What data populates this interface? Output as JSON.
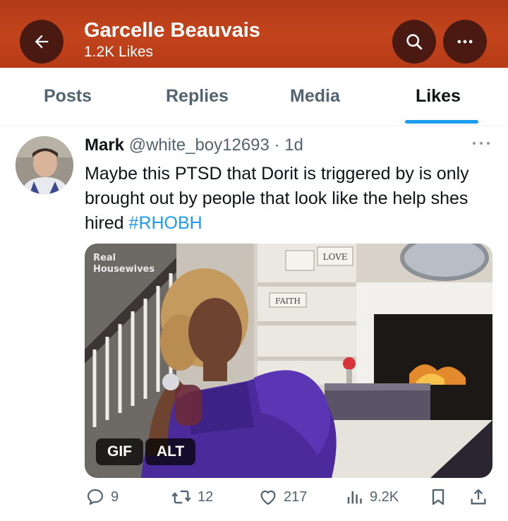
{
  "header": {
    "title": "Garcelle Beauvais",
    "subtitle": "1.2K Likes",
    "back_icon": "arrow-left-icon",
    "search_icon": "search-icon",
    "more_icon": "more-horizontal-icon",
    "background_color": "#b83b18"
  },
  "tabs": [
    {
      "label": "Posts",
      "active": false
    },
    {
      "label": "Replies",
      "active": false
    },
    {
      "label": "Media",
      "active": false
    },
    {
      "label": "Likes",
      "active": true
    }
  ],
  "tweet": {
    "name": "Mark",
    "handle": "@white_boy12693",
    "time": "· 1d",
    "text": "Maybe this PTSD that Dorit is triggered by is only brought out by people that look like the help shes hired ",
    "hashtag": "#RHOBH",
    "media": {
      "gif_label": "GIF",
      "alt_label": "ALT",
      "overlay_logo_line1": "Real",
      "overlay_logo_line2": "Housewives",
      "sign_love": "LOVE",
      "sign_faith": "FAITH"
    },
    "actions": {
      "replies": "9",
      "reposts": "12",
      "likes": "217",
      "views": "9.2K"
    }
  },
  "colors": {
    "accent": "#1d9bf0",
    "muted_text": "#536471",
    "primary_text": "#0f1419"
  }
}
